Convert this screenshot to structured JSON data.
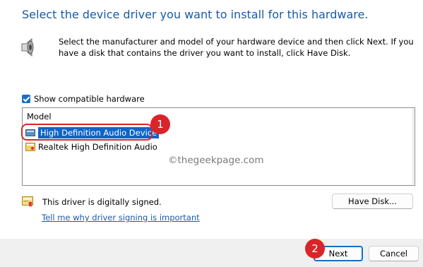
{
  "heading": "Select the device driver you want to install for this hardware.",
  "description": "Select the manufacturer and model of your hardware device and then click Next. If you have a disk that contains the driver you want to install, click Have Disk.",
  "show_compatible": {
    "label": "Show compatible hardware",
    "checked": true
  },
  "model_list": {
    "header": "Model",
    "items": [
      {
        "label": "High Definition Audio Device",
        "selected": true
      },
      {
        "label": "Realtek High Definition Audio",
        "selected": false
      }
    ]
  },
  "watermark": "©thegeekpage.com",
  "driver_signed": "This driver is digitally signed.",
  "why_link": "Tell me why driver signing is important",
  "buttons": {
    "have_disk": "Have Disk...",
    "next": "Next",
    "cancel": "Cancel"
  },
  "annotations": [
    "1",
    "2"
  ],
  "colors": {
    "heading": "#1a5aa8",
    "selection": "#0f64c8",
    "annotation": "#d9252a",
    "focus_border": "#1a6fc2"
  }
}
